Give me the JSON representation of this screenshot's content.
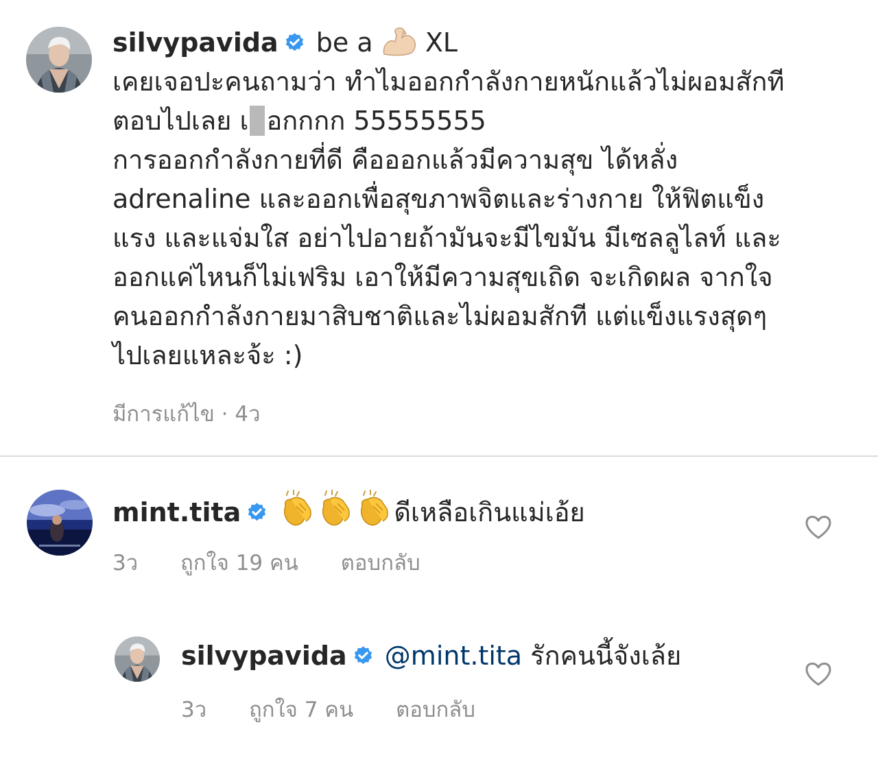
{
  "caption": {
    "username": "silvypavida",
    "title_text": "be a",
    "title_text_2": "XL",
    "lines": [
      "เคยเจอปะคนถามว่า ทำไมออกกำลังกายหนักแล้วไม่ผอมสักที",
      "ตอบไปเลย เ",
      "อกกกก 55555555",
      "การออกกำลังกายที่ดี คือออกแล้วมีความสุข ได้หลั่ง",
      "adrenaline และออกเพื่อสุขภาพจิตและร่างกาย ให้ฟิตแข็ง",
      "แรง และแจ่มใส อย่าไปอายถ้ามันจะมีไขมัน มีเซลลูไลท์ และ",
      "ออกแค่ไหนก็ไม่เฟริม เอาให้มีความสุขเถิด จะเกิดผล จากใจ",
      "คนออกกำลังกายมาสิบชาติและไม่ผอมสักที แต่แข็งแรงสุดๆ",
      "ไปเลยแหละจ้ะ :)"
    ],
    "edited_label": "มีการแก้ไข · 4ว"
  },
  "comments": [
    {
      "username": "mint.tita",
      "text": "ดีเหลือเกินแม่เอ้ย",
      "time": "3ว",
      "likes": "ถูกใจ 19 คน",
      "reply_label": "ตอบกลับ"
    },
    {
      "username": "silvypavida",
      "mention": "@mint.tita",
      "text": " รักคนนี้จังเล้ย",
      "time": "3ว",
      "likes": "ถูกใจ 7 คน",
      "reply_label": "ตอบกลับ"
    }
  ],
  "icons": {
    "verified": "verified-badge-icon",
    "flexed_biceps": "flexed-biceps-emoji",
    "clapping_hands": "clapping-hands-emoji",
    "heart": "heart-outline-icon"
  },
  "colors": {
    "verified": "#3897f0",
    "text": "#262626",
    "meta": "#8e8e8e",
    "mention": "#00376b",
    "divider": "#dbdbdb"
  }
}
